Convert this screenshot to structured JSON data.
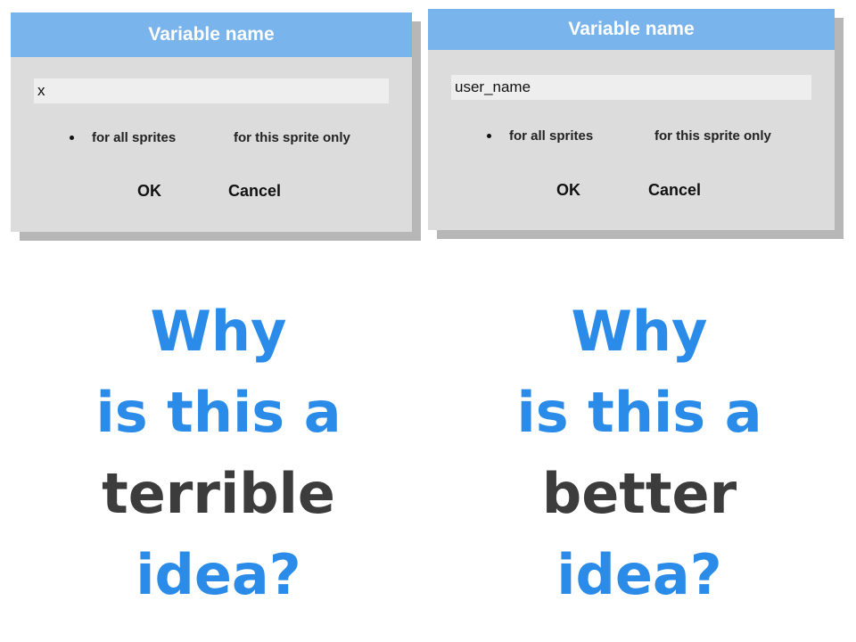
{
  "left_dialog": {
    "title": "Variable name",
    "input_value": "x",
    "radio_all": "for all sprites",
    "radio_this": "for this sprite only",
    "ok": "OK",
    "cancel": "Cancel"
  },
  "right_dialog": {
    "title": "Variable name",
    "input_value": "user_name",
    "radio_all": "for all sprites",
    "radio_this": "for this sprite only",
    "ok": "OK",
    "cancel": "Cancel"
  },
  "left_question": {
    "line1": "Why",
    "line2": "is this a",
    "line3": "terrible",
    "line4": "idea?"
  },
  "right_question": {
    "line1": "Why",
    "line2": "is this a",
    "line3": "better",
    "line4": "idea?"
  },
  "colors": {
    "accent_blue": "#2a8be8",
    "dark_text": "#3c3c3c",
    "titlebar": "#7ab4ec",
    "dialog_bg": "#dcdcdc"
  }
}
